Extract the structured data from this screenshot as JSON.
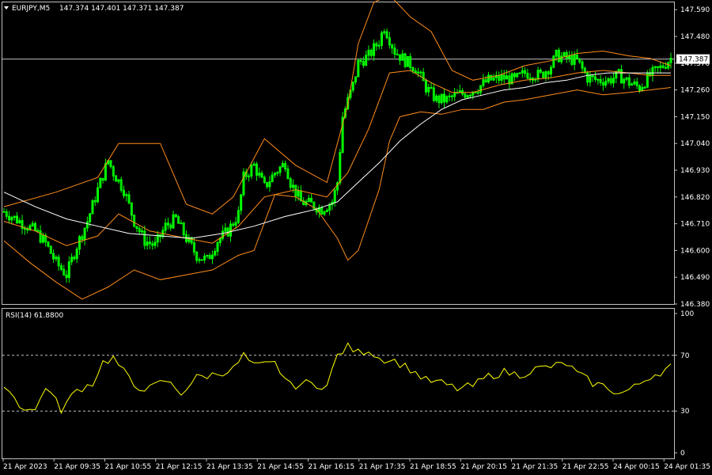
{
  "header": {
    "symbol": "EURJPY,M5",
    "ohlc": "147.374 147.401 147.371 147.387"
  },
  "rsi_header": "RSI(14) 61.8800",
  "price_tag": "147.387",
  "colors": {
    "background": "#000000",
    "frame": "#c0c0c0",
    "candle": "#00ff00",
    "bollinger": "#ff8c1a",
    "moving_average": "#ffffff",
    "rsi_line": "#ffff00",
    "level_line": "#c0c0c0",
    "price_line": "#c0c0c0"
  },
  "chart_data": [
    {
      "type": "candlestick",
      "title": "EURJPY,M5",
      "ylim": [
        146.38,
        147.62
      ],
      "yticks": [
        "147.590",
        "147.480",
        "147.370",
        "147.260",
        "147.150",
        "147.040",
        "146.930",
        "146.820",
        "146.710",
        "146.600",
        "146.490",
        "146.380"
      ],
      "xticks": [
        "21 Apr 2023",
        "21 Apr 09:35",
        "21 Apr 10:55",
        "21 Apr 12:15",
        "21 Apr 13:35",
        "21 Apr 14:55",
        "21 Apr 16:15",
        "21 Apr 17:35",
        "21 Apr 18:55",
        "21 Apr 20:15",
        "21 Apr 21:35",
        "21 Apr 22:55",
        "24 Apr 00:15",
        "24 Apr 01:35"
      ],
      "current_price": 147.387,
      "indicators": [
        "Bollinger Bands (upper, middle, lower)",
        "Moving Average"
      ],
      "close_path": [
        [
          0,
          146.76
        ],
        [
          3,
          146.72
        ],
        [
          6,
          146.68
        ],
        [
          8,
          146.63
        ],
        [
          10,
          146.55
        ],
        [
          12,
          146.5
        ],
        [
          14,
          146.62
        ],
        [
          16,
          146.72
        ],
        [
          18,
          146.85
        ],
        [
          20,
          146.97
        ],
        [
          21,
          146.92
        ],
        [
          23,
          146.85
        ],
        [
          25,
          146.72
        ],
        [
          27,
          146.64
        ],
        [
          29,
          146.62
        ],
        [
          31,
          146.7
        ],
        [
          33,
          146.73
        ],
        [
          35,
          146.65
        ],
        [
          37,
          146.58
        ],
        [
          39,
          146.56
        ],
        [
          41,
          146.64
        ],
        [
          43,
          146.68
        ],
        [
          45,
          146.75
        ],
        [
          46,
          146.9
        ],
        [
          48,
          146.95
        ],
        [
          50,
          146.86
        ],
        [
          52,
          146.92
        ],
        [
          54,
          146.96
        ],
        [
          55,
          146.88
        ],
        [
          57,
          146.8
        ],
        [
          59,
          146.79
        ],
        [
          61,
          146.77
        ],
        [
          63,
          146.8
        ],
        [
          64,
          146.88
        ],
        [
          65,
          147.15
        ],
        [
          67,
          147.28
        ],
        [
          68,
          147.37
        ],
        [
          70,
          147.4
        ],
        [
          72,
          147.46
        ],
        [
          73,
          147.52
        ],
        [
          75,
          147.42
        ],
        [
          77,
          147.38
        ],
        [
          79,
          147.35
        ],
        [
          81,
          147.27
        ],
        [
          83,
          147.22
        ],
        [
          85,
          147.22
        ],
        [
          87,
          147.24
        ],
        [
          89,
          147.25
        ],
        [
          91,
          147.27
        ],
        [
          93,
          147.3
        ],
        [
          96,
          147.31
        ],
        [
          98,
          147.3
        ],
        [
          100,
          147.33
        ],
        [
          103,
          147.32
        ],
        [
          105,
          147.36
        ],
        [
          106,
          147.4
        ],
        [
          108,
          147.39
        ],
        [
          110,
          147.38
        ],
        [
          112,
          147.31
        ],
        [
          114,
          147.3
        ],
        [
          116,
          147.3
        ],
        [
          118,
          147.32
        ],
        [
          120,
          147.29
        ],
        [
          122,
          147.27
        ],
        [
          124,
          147.32
        ],
        [
          126,
          147.35
        ],
        [
          128,
          147.39
        ]
      ],
      "bollinger_upper": [
        [
          0,
          146.78
        ],
        [
          10,
          146.84
        ],
        [
          18,
          146.9
        ],
        [
          22,
          147.04
        ],
        [
          30,
          147.04
        ],
        [
          35,
          146.79
        ],
        [
          40,
          146.75
        ],
        [
          44,
          146.82
        ],
        [
          50,
          147.06
        ],
        [
          56,
          146.95
        ],
        [
          62,
          146.88
        ],
        [
          66,
          147.2
        ],
        [
          68,
          147.45
        ],
        [
          71,
          147.62
        ],
        [
          74,
          147.65
        ],
        [
          78,
          147.56
        ],
        [
          82,
          147.5
        ],
        [
          86,
          147.34
        ],
        [
          90,
          147.3
        ],
        [
          95,
          147.32
        ],
        [
          100,
          147.36
        ],
        [
          105,
          147.38
        ],
        [
          110,
          147.41
        ],
        [
          115,
          147.42
        ],
        [
          120,
          147.4
        ],
        [
          124,
          147.39
        ],
        [
          128,
          147.36
        ]
      ],
      "bollinger_middle": [
        [
          0,
          146.72
        ],
        [
          6,
          146.68
        ],
        [
          12,
          146.62
        ],
        [
          18,
          146.66
        ],
        [
          22,
          146.75
        ],
        [
          28,
          146.68
        ],
        [
          35,
          146.65
        ],
        [
          40,
          146.63
        ],
        [
          45,
          146.7
        ],
        [
          50,
          146.82
        ],
        [
          56,
          146.85
        ],
        [
          62,
          146.82
        ],
        [
          66,
          146.92
        ],
        [
          70,
          147.1
        ],
        [
          74,
          147.33
        ],
        [
          78,
          147.34
        ],
        [
          82,
          147.29
        ],
        [
          86,
          147.25
        ],
        [
          90,
          147.25
        ],
        [
          95,
          147.28
        ],
        [
          100,
          147.3
        ],
        [
          105,
          147.31
        ],
        [
          110,
          147.33
        ],
        [
          115,
          147.34
        ],
        [
          120,
          147.33
        ],
        [
          124,
          147.32
        ],
        [
          128,
          147.32
        ]
      ],
      "bollinger_lower": [
        [
          0,
          146.64
        ],
        [
          5,
          146.55
        ],
        [
          10,
          146.47
        ],
        [
          15,
          146.4
        ],
        [
          20,
          146.45
        ],
        [
          25,
          146.52
        ],
        [
          30,
          146.48
        ],
        [
          35,
          146.5
        ],
        [
          40,
          146.52
        ],
        [
          45,
          146.58
        ],
        [
          48,
          146.6
        ],
        [
          52,
          146.83
        ],
        [
          56,
          146.82
        ],
        [
          60,
          146.77
        ],
        [
          64,
          146.65
        ],
        [
          66,
          146.56
        ],
        [
          68,
          146.6
        ],
        [
          72,
          146.85
        ],
        [
          74,
          147.05
        ],
        [
          76,
          147.15
        ],
        [
          80,
          147.17
        ],
        [
          84,
          147.16
        ],
        [
          88,
          147.18
        ],
        [
          92,
          147.18
        ],
        [
          96,
          147.21
        ],
        [
          100,
          147.22
        ],
        [
          105,
          147.24
        ],
        [
          110,
          147.26
        ],
        [
          115,
          147.24
        ],
        [
          120,
          147.25
        ],
        [
          124,
          147.26
        ],
        [
          128,
          147.27
        ]
      ],
      "moving_average": [
        [
          0,
          146.84
        ],
        [
          6,
          146.78
        ],
        [
          12,
          146.73
        ],
        [
          18,
          146.7
        ],
        [
          24,
          146.67
        ],
        [
          30,
          146.66
        ],
        [
          36,
          146.65
        ],
        [
          42,
          146.67
        ],
        [
          48,
          146.7
        ],
        [
          54,
          146.74
        ],
        [
          60,
          146.77
        ],
        [
          64,
          146.8
        ],
        [
          68,
          146.88
        ],
        [
          72,
          146.96
        ],
        [
          76,
          147.05
        ],
        [
          80,
          147.12
        ],
        [
          84,
          147.18
        ],
        [
          88,
          147.22
        ],
        [
          92,
          147.24
        ],
        [
          96,
          147.26
        ],
        [
          100,
          147.27
        ],
        [
          104,
          147.29
        ],
        [
          108,
          147.3
        ],
        [
          112,
          147.32
        ],
        [
          116,
          147.33
        ],
        [
          120,
          147.33
        ],
        [
          124,
          147.33
        ],
        [
          128,
          147.33
        ]
      ]
    },
    {
      "type": "line",
      "title": "RSI(14) 61.8800",
      "ylim": [
        0,
        100
      ],
      "yticks": [
        "100",
        "70",
        "30",
        "0"
      ],
      "levels": [
        70,
        30
      ],
      "current_value": 61.88,
      "series": [
        {
          "name": "RSI(14)",
          "values": [
            [
              0,
              50
            ],
            [
              3,
              34
            ],
            [
              6,
              30
            ],
            [
              8,
              48
            ],
            [
              11,
              31
            ],
            [
              14,
              45
            ],
            [
              17,
              50
            ],
            [
              19,
              65
            ],
            [
              21,
              68
            ],
            [
              23,
              58
            ],
            [
              25,
              48
            ],
            [
              28,
              46
            ],
            [
              31,
              52
            ],
            [
              34,
              43
            ],
            [
              37,
              54
            ],
            [
              40,
              56
            ],
            [
              44,
              60
            ],
            [
              46,
              70
            ],
            [
              48,
              62
            ],
            [
              52,
              64
            ],
            [
              55,
              48
            ],
            [
              58,
              50
            ],
            [
              62,
              48
            ],
            [
              64,
              70
            ],
            [
              66,
              76
            ],
            [
              68,
              72
            ],
            [
              70,
              74
            ],
            [
              72,
              68
            ],
            [
              75,
              66
            ],
            [
              78,
              60
            ],
            [
              81,
              52
            ],
            [
              84,
              50
            ],
            [
              87,
              46
            ],
            [
              90,
              48
            ],
            [
              93,
              55
            ],
            [
              96,
              58
            ],
            [
              99,
              56
            ],
            [
              102,
              60
            ],
            [
              105,
              62
            ],
            [
              108,
              64
            ],
            [
              110,
              57
            ],
            [
              113,
              50
            ],
            [
              116,
              47
            ],
            [
              118,
              42
            ],
            [
              121,
              47
            ],
            [
              124,
              55
            ],
            [
              126,
              58
            ],
            [
              128,
              62
            ]
          ]
        }
      ]
    }
  ]
}
